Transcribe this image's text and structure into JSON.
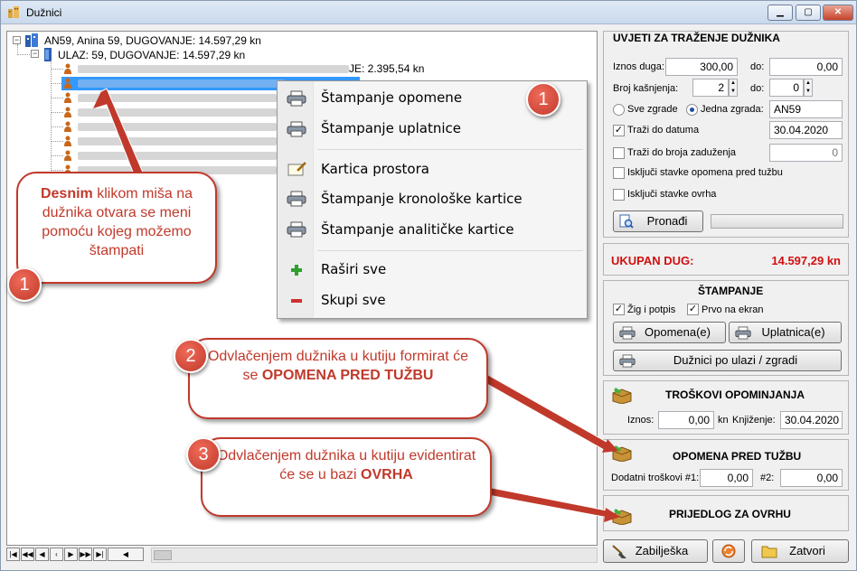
{
  "window": {
    "title": "Dužnici"
  },
  "tree": {
    "root": "AN59, Anina 59,  DUGOVANJE: 14.597,29 kn",
    "entrance": "ULAZ: 59,  DUGOVANJE: 14.597,29 kn",
    "first_child_suffix": "JE: 2.395,54 kn"
  },
  "context_menu": {
    "items": [
      "Štampanje opomene",
      "Štampanje uplatnice",
      "Kartica prostora",
      "Štampanje kronološke kartice",
      "Štampanje analitičke kartice",
      "Raširi sve",
      "Skupi sve"
    ]
  },
  "search": {
    "title": "UVJETI ZA TRAŽENJE DUŽNIKA",
    "amount_label": "Iznos duga:",
    "amount_from": "300,00",
    "to_label": "do:",
    "amount_to": "0,00",
    "delays_label": "Broj kašnjenja:",
    "delays_from": "2",
    "delays_to_label": "do:",
    "delays_to": "0",
    "all_buildings": "Sve zgrade",
    "one_building": "Jedna zgrada:",
    "building": "AN59",
    "until_date_label": "Traži do datuma",
    "until_date": "30.04.2020",
    "until_debit_label": "Traži do broja zaduženja",
    "until_debit": "0",
    "exclude_warning": "Isključi stavke opomena pred tužbu",
    "exclude_enforcement": "Isključi stavke ovrha",
    "find_button": "Pronađi"
  },
  "total": {
    "label": "UKUPAN DUG:",
    "value": "14.597,29 kn"
  },
  "printing": {
    "title": "ŠTAMPANJE",
    "stamp": "Žig i potpis",
    "screen_first": "Prvo na ekran",
    "warning_btn": "Opomena(e)",
    "payslip_btn": "Uplatnica(e)",
    "by_entrance_btn": "Dužnici po ulazi / zgradi"
  },
  "costs": {
    "title": "TROŠKOVI OPOMINJANJA",
    "amount_label": "Iznos:",
    "amount": "0,00",
    "unit": "kn",
    "posting_label": "Knjiženje:",
    "posting_date": "30.04.2020"
  },
  "lawsuit": {
    "title": "OPOMENA PRED TUŽBU",
    "extra1_label": "Dodatni troškovi #1:",
    "extra1": "0,00",
    "extra2_label": "#2:",
    "extra2": "0,00"
  },
  "enforcement": {
    "title": "PRIJEDLOG ZA OVRHU"
  },
  "bottom": {
    "note_btn": "Zabilješka",
    "close_btn": "Zatvori"
  },
  "callouts": {
    "c1_bold": "Desnim",
    "c1_rest": " klikom miša na dužnika otvara se meni pomoću kojeg možemo štampati",
    "c2_text": "Odvlačenjem dužnika u kutiju formirat će se ",
    "c2_bold": "OPOMENA PRED TUŽBU",
    "c3_text": "Odvlačenjem dužnika u kutiju evidentirat će se u bazi ",
    "c3_bold": "OVRHA",
    "badge1": "1",
    "badge1b": "1",
    "badge2": "2",
    "badge3": "3"
  },
  "colors": {
    "accent_red": "#c0392b",
    "selection": "#3399ff"
  }
}
